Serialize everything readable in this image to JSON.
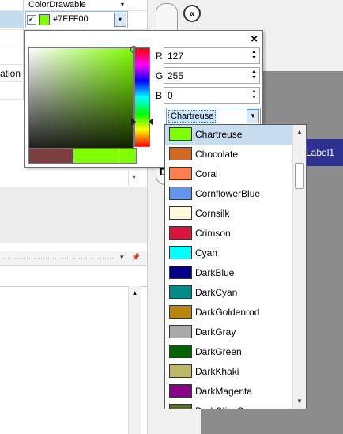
{
  "property_grid": {
    "header_label": "ColorDrawable",
    "header_arrow": "▾",
    "color_value": "#7FFF00",
    "color_hex": "#7FFF00",
    "checkbox_mark": "✓",
    "cell_dropdown_arrow": "▾",
    "truncated_label": "ation",
    "scroll_down_arrow": "▾"
  },
  "panel_header": {
    "dropdown_icon": "▾",
    "pin_icon": "📌"
  },
  "designer": {
    "back_glyph": "«",
    "label1_text": "Label1",
    "partial_text": "D"
  },
  "picker": {
    "close_glyph": "×",
    "r_label": "R",
    "g_label": "G",
    "b_label": "B",
    "r_value": "127",
    "g_value": "255",
    "b_value": "0",
    "spin_up": "▲",
    "spin_down": "▼",
    "name_value": "Chartreuse",
    "name_arrow": "▼",
    "swatches": [
      "#7b3f3f",
      "#7fff00",
      "#7fff00"
    ]
  },
  "color_list": {
    "items": [
      {
        "name": "Chartreuse",
        "color": "#7FFF00"
      },
      {
        "name": "Chocolate",
        "color": "#D2691E"
      },
      {
        "name": "Coral",
        "color": "#FF7F50"
      },
      {
        "name": "CornflowerBlue",
        "color": "#6495ED"
      },
      {
        "name": "Cornsilk",
        "color": "#FFF8DC"
      },
      {
        "name": "Crimson",
        "color": "#DC143C"
      },
      {
        "name": "Cyan",
        "color": "#00FFFF"
      },
      {
        "name": "DarkBlue",
        "color": "#00008B"
      },
      {
        "name": "DarkCyan",
        "color": "#008B8B"
      },
      {
        "name": "DarkGoldenrod",
        "color": "#B8860B"
      },
      {
        "name": "DarkGray",
        "color": "#A9A9A9"
      },
      {
        "name": "DarkGreen",
        "color": "#006400"
      },
      {
        "name": "DarkKhaki",
        "color": "#BDB76B"
      },
      {
        "name": "DarkMagenta",
        "color": "#8B008B"
      },
      {
        "name": "DarkOliveGreen",
        "color": "#556B2F"
      }
    ],
    "selected_name": "Chartreuse",
    "scroll_up": "▲",
    "scroll_down": "▼"
  }
}
